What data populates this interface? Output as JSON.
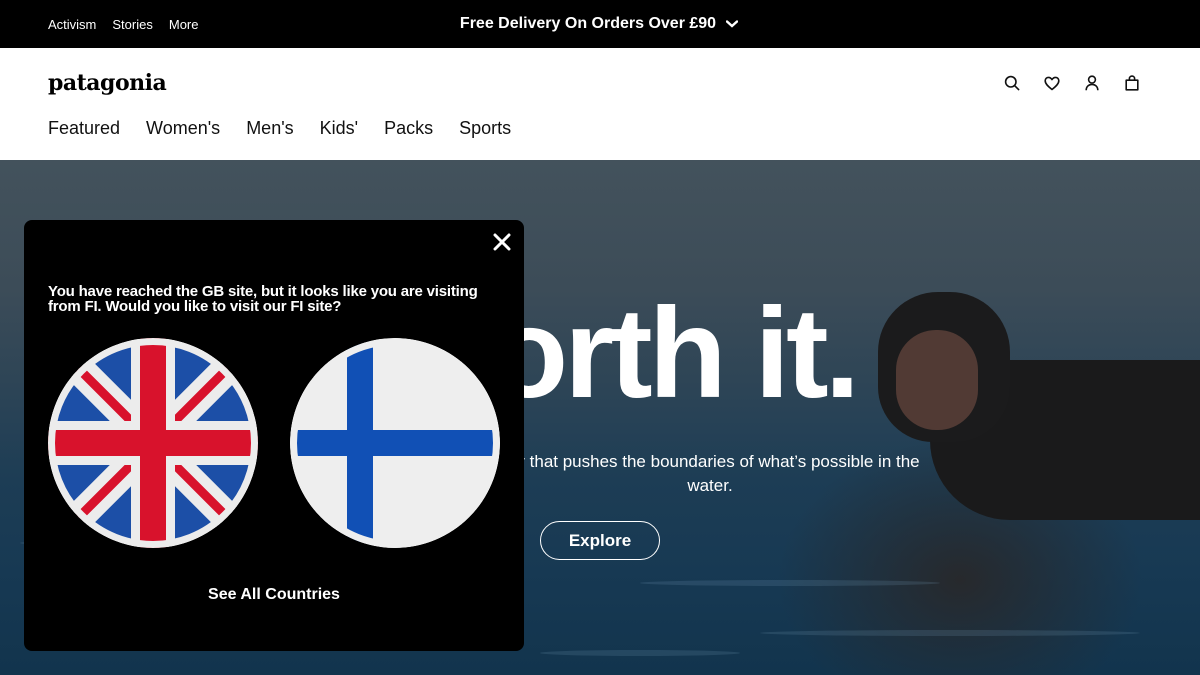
{
  "topbar": {
    "links": [
      "Activism",
      "Stories",
      "More"
    ],
    "promo": "Free Delivery On Orders Over £90",
    "promo_icon": "chevron-down-icon"
  },
  "header": {
    "logo": "patagonia",
    "nav": [
      "Featured",
      "Women's",
      "Men's",
      "Kids'",
      "Packs",
      "Sports"
    ],
    "utility_icons": [
      "search-icon",
      "heart-icon",
      "user-icon",
      "bag-icon"
    ]
  },
  "hero": {
    "title": "orth it.",
    "subtitle": "ear that pushes the boundaries of what’s possible in the water.",
    "cta": "Explore"
  },
  "modal": {
    "message": "You have reached the GB site, but it looks like you are visiting from FI. Would you like to visit our FI site?",
    "flags": [
      "uk-flag-icon",
      "finland-flag-icon"
    ],
    "see_all": "See All Countries",
    "close_icon": "close-icon"
  },
  "colors": {
    "topbar_bg": "#000000",
    "modal_bg": "#000000",
    "uk_blue": "#1C4FA7",
    "uk_red": "#D8122C",
    "fi_blue": "#1150B5",
    "fi_white": "#EEEEEE"
  }
}
